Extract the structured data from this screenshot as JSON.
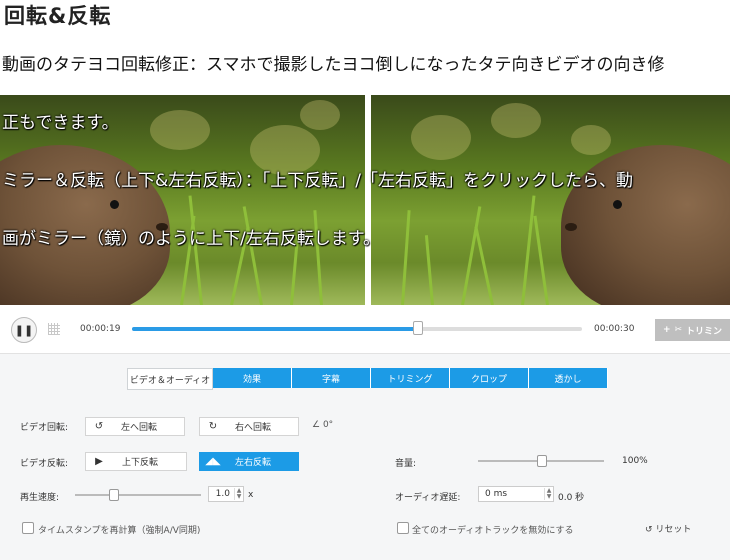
{
  "heading": "回転&反転",
  "intro_lines": [
    "動画のタテヨコ回転修正：スマホで撮影したヨコ倒しになったタテ向きビデオの向き修",
    "正もできます。",
    "ミラー＆反転（上下&左右反転）：「上下反転」/「左右反転」をクリックしたら、動",
    "画がミラー（鏡）のように上下/左右反転します。"
  ],
  "player": {
    "current_time": "00:00:19",
    "total_time": "00:00:30",
    "progress": 0.634,
    "trim_label": "トリミン",
    "trim_prefix": "+"
  },
  "tabs": [
    "ビデオ＆オーディオ",
    "効果",
    "字幕",
    "トリミング",
    "クロップ",
    "透かし"
  ],
  "settings": {
    "rotation_label": "ビデオ回転:",
    "rotate_left": "左へ回転",
    "rotate_right": "右へ回転",
    "rotation_angle": "0°",
    "flip_label": "ビデオ反転:",
    "flip_vertical": "上下反転",
    "flip_horizontal": "左右反転",
    "speed_label": "再生速度:",
    "speed_value": "1.0",
    "speed_unit": "x",
    "speed_level": 0.3,
    "volume_label": "音量:",
    "volume_value": "100%",
    "volume_level": 0.5,
    "audio_delay_label": "オーディオ遅延:",
    "audio_delay_value": "0 ms",
    "audio_delay_seconds": "0.0 秒",
    "timestamp_checkbox": "タイムスタンプを再計算（強制A/V同期)",
    "disable_audio_checkbox": "全てのオーディオトラックを無効にする",
    "reset_label": "リセット"
  },
  "colors": {
    "accent": "#1c9be6",
    "progress": "#2a9be6",
    "trim_disabled": "#bfbfbf"
  },
  "icons": {
    "rotate_left": "rotate-ccw-icon",
    "rotate_right": "rotate-cw-icon",
    "angle": "angle-icon",
    "flip_vertical": "flip-vertical-icon",
    "flip_horizontal": "flip-horizontal-icon",
    "pause": "pause-icon",
    "trim": "scissors-icon",
    "reset": "reset-icon"
  }
}
